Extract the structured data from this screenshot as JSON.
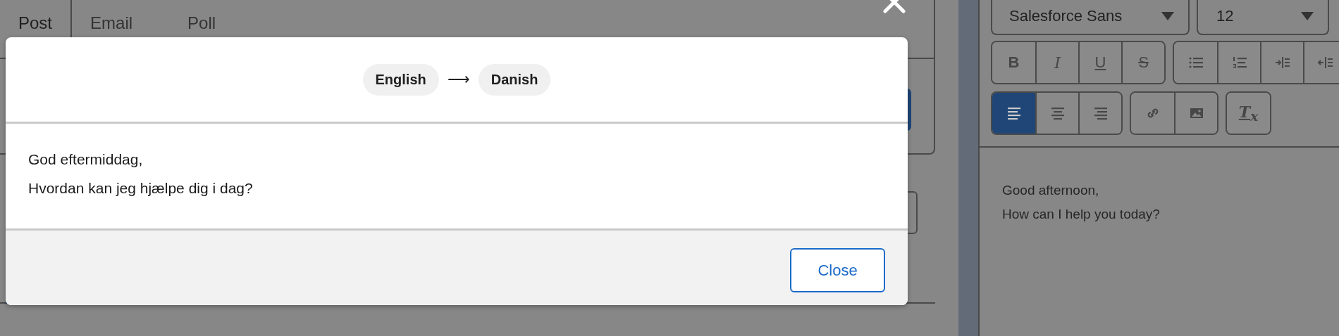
{
  "publisher": {
    "tabs": [
      {
        "label": "Post",
        "selected": true
      },
      {
        "label": "Email",
        "selected": false
      },
      {
        "label": "Poll",
        "selected": false
      }
    ]
  },
  "modal": {
    "source_language": "English",
    "arrow": "⟶",
    "target_language": "Danish",
    "lines": [
      "God eftermiddag,",
      "Hvordan kan jeg hjælpe dig i dag?"
    ],
    "close_button": "Close"
  },
  "editor": {
    "font": "Salesforce Sans",
    "size": "12",
    "toolbar_rows": [
      [
        [
          {
            "kind": "bold",
            "label": "B",
            "selected": false
          },
          {
            "kind": "italic",
            "label": "I",
            "selected": false
          },
          {
            "kind": "underline",
            "label": "U",
            "selected": false
          },
          {
            "kind": "strike",
            "label": "S",
            "selected": false
          }
        ],
        [
          {
            "kind": "bullets",
            "selected": false
          },
          {
            "kind": "numbers",
            "selected": false
          },
          {
            "kind": "indent",
            "selected": false
          },
          {
            "kind": "outdent",
            "selected": false
          }
        ]
      ],
      [
        [
          {
            "kind": "align-left",
            "selected": true
          },
          {
            "kind": "align-center",
            "selected": false
          },
          {
            "kind": "align-right",
            "selected": false
          }
        ],
        [
          {
            "kind": "link",
            "selected": false
          },
          {
            "kind": "image",
            "selected": false
          }
        ],
        [
          {
            "kind": "clear",
            "label": "T$_{x}$",
            "selected": false
          }
        ]
      ]
    ],
    "lines": [
      "Good afternoon,",
      "How can I help you today?"
    ]
  }
}
